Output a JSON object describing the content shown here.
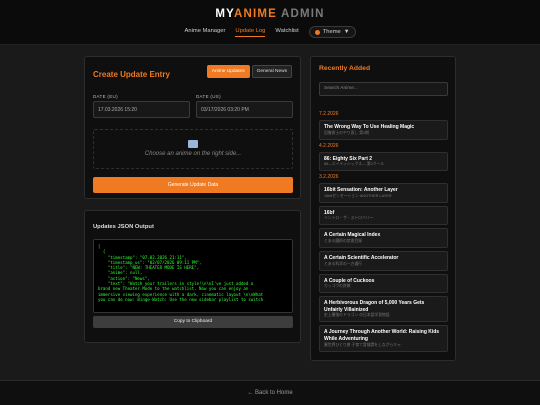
{
  "header": {
    "logo": {
      "part1": "MY",
      "part2": "ANIME",
      "part3": " ADMIN"
    },
    "nav": [
      {
        "label": "Anime Manager",
        "active": false
      },
      {
        "label": "Update Log",
        "active": true
      },
      {
        "label": "Watchlist",
        "active": false
      }
    ],
    "theme_label": "Theme",
    "theme_caret": "▼"
  },
  "create": {
    "title": "Create Update Entry",
    "tabs": [
      {
        "label": "Anime Updates",
        "active": true
      },
      {
        "label": "General News",
        "active": false
      }
    ],
    "date_eu_label": "DATE (EU)",
    "date_eu_value": "17.03.2026 15:20",
    "date_us_label": "DATE (US)",
    "date_us_value": "03/17/2026 03:20 PM",
    "placeholder_text": "Choose an anime on the right side...",
    "generate_label": "Generate Update Data"
  },
  "json_output": {
    "title": "Updates JSON Output",
    "lines": [
      "[",
      "  {",
      "    \"timestamp\": \"07.02.2026 21:11\",",
      "    \"timestamp_us\": \"02/07/2026 09:11 PM\",",
      "    \"title\": \"NEW: THEATER MODE IS HERE\",",
      "    \"anime\": null,",
      "    \"action\": \"News\",",
      "    \"text\": \"Watch your trailers in style!\\n\\nI've just added a",
      "brand new Theater Mode to the watchlist. Now you can enjoy an",
      "immersive viewing experience with a dark, cinematic layout \\n\\nWhat",
      "you can do now: Binge-Watch: Use the new sidebar playlist to switch"
    ],
    "copy_label": "Copy to Clipboard"
  },
  "recent": {
    "title": "Recently Added",
    "search_placeholder": "Search Anime...",
    "groups": [
      {
        "date": "7.2.2026",
        "entries": [
          {
            "title": "The Wrong Way To Use Healing Magic",
            "sub": "回復術士のやり直し 第2期"
          }
        ]
      },
      {
        "date": "4.2.2026",
        "entries": [
          {
            "title": "86: Eighty Six Part 2",
            "sub": "86―エイティシックス― 第2クール"
          }
        ]
      },
      {
        "date": "3.2.2026",
        "entries": [
          {
            "title": "16bit Sensation: Another Layer",
            "sub": "16bitセンセーション ANOTHER LAYER"
          },
          {
            "title": "16bf",
            "sub": "イントロ・ザ・ストロベリー"
          },
          {
            "title": "A Certain Magical Index",
            "sub": "とある魔術の禁書目録"
          },
          {
            "title": "A Certain Scientific Accelerator",
            "sub": "とある科学の一方通行"
          },
          {
            "title": "A Couple of Cuckoos",
            "sub": "カッコウの許嫁"
          },
          {
            "title": "A Herbivorous Dragon of 5,000 Years Gets Unfairly Villainized",
            "sub": "史上最強のドラゴン の日本語学習物語"
          },
          {
            "title": "A Journey Through Another World: Raising Kids While Adventuring",
            "sub": "異世界ひとり旅 子育て冒険譚をしながらキャ"
          }
        ]
      }
    ]
  },
  "footer": {
    "back_label": "← Back to Home"
  }
}
